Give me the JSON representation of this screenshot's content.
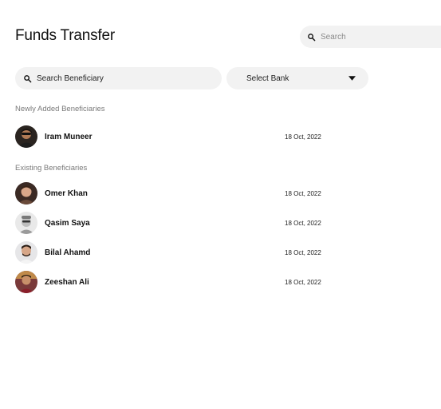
{
  "header": {
    "title": "Funds Transfer",
    "search_placeholder": "Search"
  },
  "filters": {
    "beneficiary_search_placeholder": "Search Beneficiary",
    "bank_select_label": "Select Bank"
  },
  "sections": {
    "newly_added_title": "Newly Added Beneficiaries",
    "existing_title": "Existing Beneficiaries"
  },
  "newly_added": [
    {
      "name": "Iram Muneer",
      "date": "18 Oct, 2022"
    }
  ],
  "existing": [
    {
      "name": "Omer Khan",
      "date": "18 Oct, 2022"
    },
    {
      "name": "Qasim Saya",
      "date": "18 Oct, 2022"
    },
    {
      "name": "Bilal Ahamd",
      "date": "18 Oct, 2022"
    },
    {
      "name": "Zeeshan Ali",
      "date": "18 Oct, 2022"
    }
  ],
  "icons": {
    "top_search": "search-icon",
    "beneficiary_search": "search-icon",
    "bank_dropdown": "caret-down-icon"
  }
}
